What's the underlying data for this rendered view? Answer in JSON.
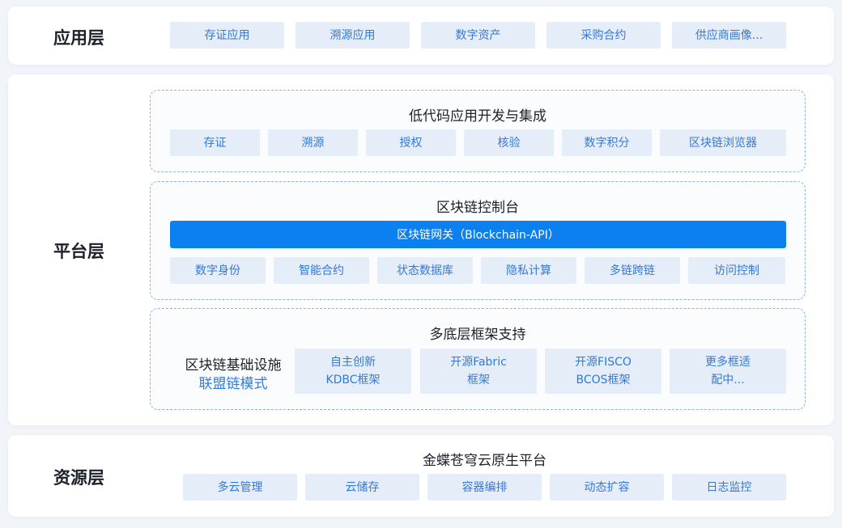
{
  "application_layer": {
    "title": "应用层",
    "items": [
      "存证应用",
      "溯源应用",
      "数字资产",
      "采购合约",
      "供应商画像..."
    ]
  },
  "platform_layer": {
    "title": "平台层",
    "low_code": {
      "title": "低代码应用开发与集成",
      "items": [
        "存证",
        "溯源",
        "授权",
        "核验",
        "数字积分",
        "区块链浏览器"
      ]
    },
    "console": {
      "title": "区块链控制台",
      "gateway": "区块链网关（Blockchain-API）",
      "items": [
        "数字身份",
        "智能合约",
        "状态数据库",
        "隐私计算",
        "多链跨链",
        "访问控制"
      ]
    },
    "framework": {
      "title": "多底层框架支持",
      "infra_label": "区块链基础设施",
      "infra_mode": "联盟链模式",
      "items": [
        {
          "line1": "自主创新",
          "line2": "KDBC框架"
        },
        {
          "line1": "开源Fabric",
          "line2": "框架"
        },
        {
          "line1": "开源FISCO",
          "line2": "BCOS框架"
        },
        {
          "line1": "更多框适",
          "line2": "配中..."
        }
      ]
    }
  },
  "resource_layer": {
    "title": "资源层",
    "platform": "金蝶苍穹云原生平台",
    "items": [
      "多云管理",
      "云储存",
      "容器编排",
      "动态扩容",
      "日志监控"
    ]
  },
  "colors": {
    "chip_bg": "#e4edf8",
    "chip_text": "#3579d7",
    "gateway_bg": "#0b80ee",
    "panel_border": "#8ab5ec",
    "infra_mode_text": "#2f7be0"
  }
}
